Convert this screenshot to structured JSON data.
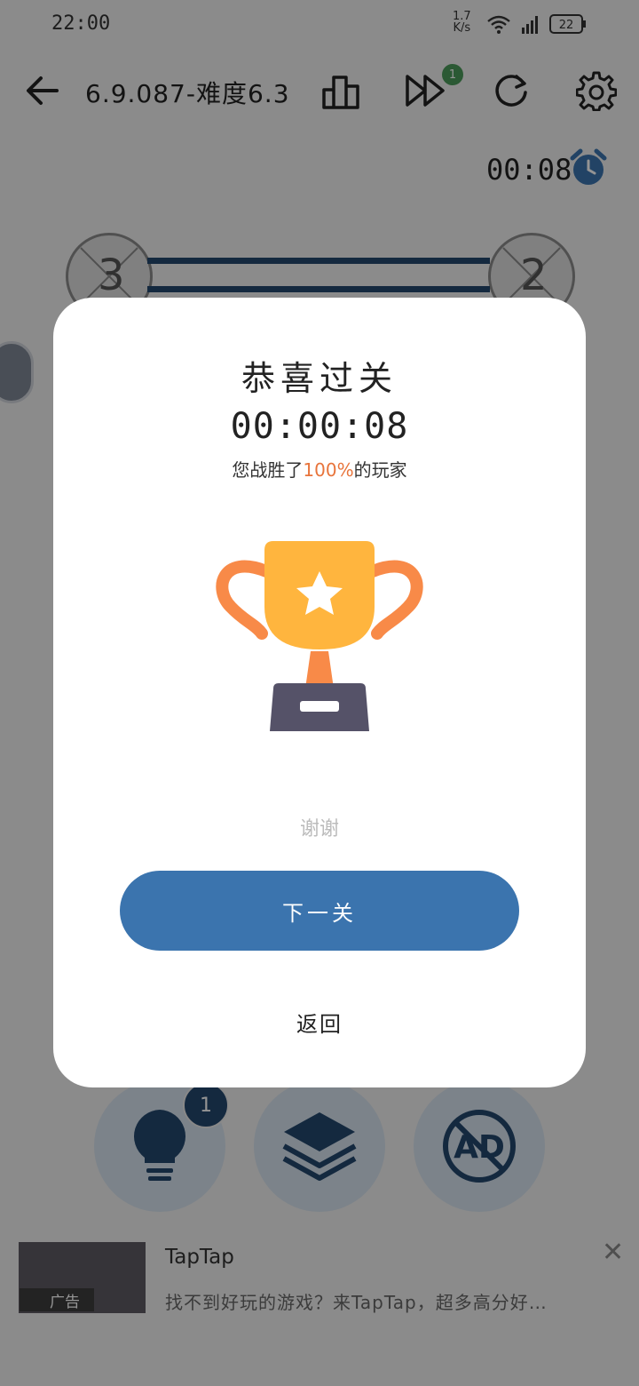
{
  "status_bar": {
    "time": "22:00",
    "net_speed_value": "1.7",
    "net_speed_unit": "K/s",
    "battery": "22"
  },
  "header": {
    "title": "6.9.087-难度6.3",
    "skip_badge": "1"
  },
  "timer": {
    "text": "00:08"
  },
  "board": {
    "left_digit": "3",
    "right_digit": "2"
  },
  "dialog": {
    "title": "恭喜过关",
    "time": "00:00:08",
    "beat_prefix": "您战胜了",
    "beat_percent": "100%",
    "beat_suffix": "的玩家",
    "thanks": "谢谢",
    "next_button": "下一关",
    "back_button": "返回"
  },
  "tools": {
    "hint_badge": "1"
  },
  "ad": {
    "label": "广告",
    "name": "TapTap",
    "description": "找不到好玩的游戏？来TapTap，超多高分好…"
  },
  "colors": {
    "accent": "#3b74ae",
    "navy": "#24476d",
    "orange": "#e8743b",
    "trophy_gold": "#ffb53e"
  }
}
